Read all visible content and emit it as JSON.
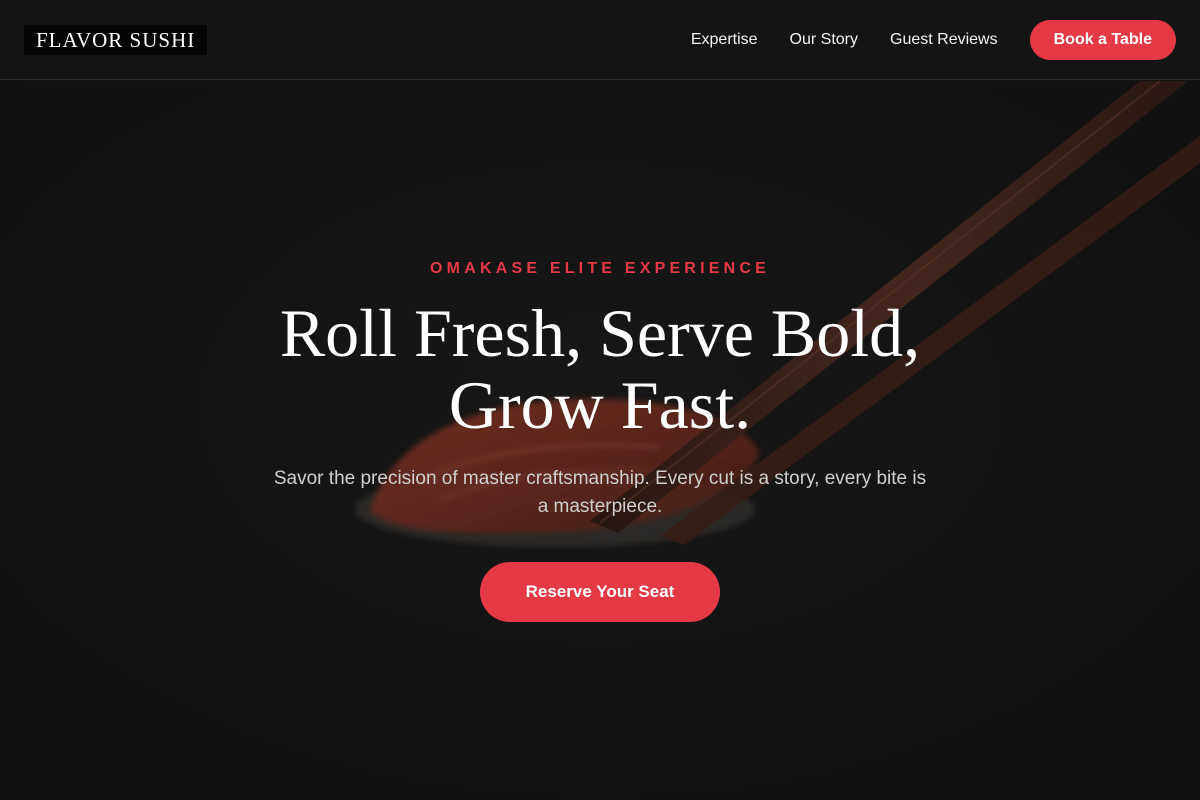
{
  "header": {
    "logo_text": "FLAVOR SUSHI",
    "nav": [
      {
        "label": "Expertise"
      },
      {
        "label": "Our Story"
      },
      {
        "label": "Guest Reviews"
      }
    ],
    "cta_label": "Book a Table"
  },
  "hero": {
    "eyebrow": "OMAKASE ELITE EXPERIENCE",
    "headline_line1": "Roll Fresh, Serve Bold,",
    "headline_line2": "Grow Fast.",
    "subtext": "Savor the precision of master craftsmanship. Every cut is a story, every bite is a masterpiece.",
    "cta_label": "Reserve Your Seat",
    "background_image": "sushi-nigiri-with-chopsticks"
  },
  "colors": {
    "accent": "#e63946",
    "background": "#131313",
    "text": "#ffffff",
    "muted_text": "#cfcfcf"
  }
}
